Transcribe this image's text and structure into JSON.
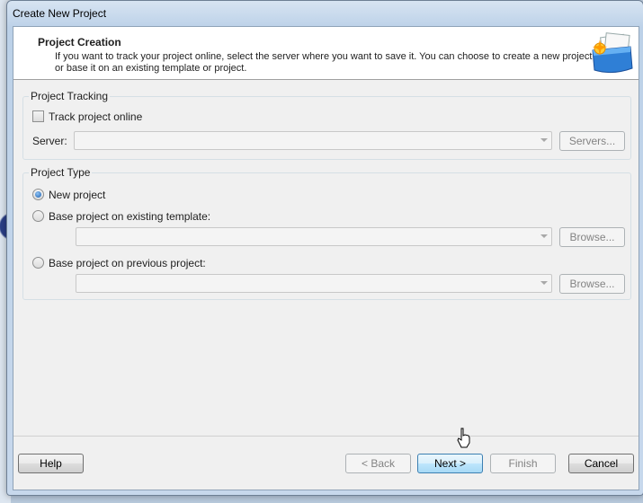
{
  "window": {
    "title": "Create New Project"
  },
  "header": {
    "title": "Project Creation",
    "description": "If you want to track your project online, select the server where you want to save it. You can choose to create a new project or base it on an existing template or project.",
    "icon": "project-folder-icon"
  },
  "tracking": {
    "group_label": "Project Tracking",
    "track_online_label": "Track project online",
    "track_online_checked": false,
    "server_label": "Server:",
    "server_value": "",
    "servers_button": "Servers..."
  },
  "project_type": {
    "group_label": "Project Type",
    "selected": "new",
    "options": [
      {
        "id": "new",
        "label": "New project"
      },
      {
        "id": "template",
        "label": "Base project on existing template:",
        "combo_value": "",
        "browse_label": "Browse..."
      },
      {
        "id": "previous",
        "label": "Base project on previous project:",
        "combo_value": "",
        "browse_label": "Browse..."
      }
    ]
  },
  "footer": {
    "help": "Help",
    "back": "< Back",
    "next": "Next >",
    "finish": "Finish",
    "cancel": "Cancel"
  },
  "colors": {
    "focus_border": "#3c7fb1",
    "radio_selected": "#1b5fb0"
  }
}
